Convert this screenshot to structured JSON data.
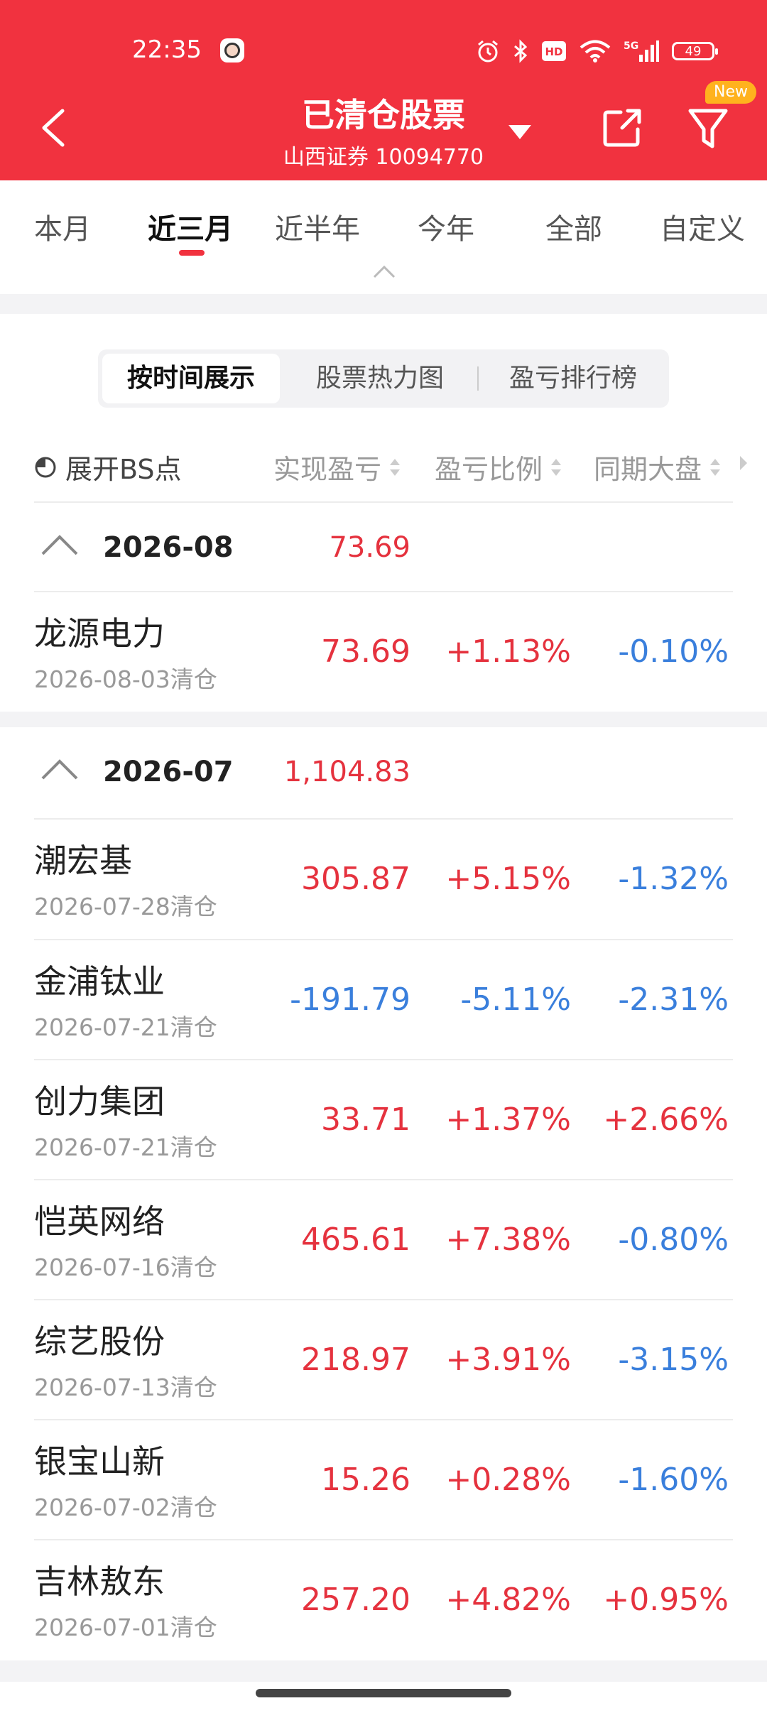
{
  "status_bar": {
    "time": "22:35",
    "battery": "49",
    "icons": [
      "alarm-icon",
      "bluetooth-icon",
      "hd-icon",
      "wifi-icon",
      "5g-signal-icon",
      "battery-icon"
    ]
  },
  "header": {
    "title": "已清仓股票",
    "subtitle": "山西证券 10094770",
    "new_badge": "New",
    "bg_color": "#f1323f"
  },
  "period_tabs": [
    {
      "label": "本月",
      "active": false
    },
    {
      "label": "近三月",
      "active": true
    },
    {
      "label": "近半年",
      "active": false
    },
    {
      "label": "今年",
      "active": false
    },
    {
      "label": "全部",
      "active": false
    },
    {
      "label": "自定义",
      "active": false
    }
  ],
  "view_tabs": [
    {
      "label": "按时间展示",
      "active": true
    },
    {
      "label": "股票热力图",
      "active": false
    },
    {
      "label": "盈亏排行榜",
      "active": false
    }
  ],
  "columns": {
    "bs_toggle": "展开BS点",
    "pnl": "实现盈亏",
    "ratio": "盈亏比例",
    "market": "同期大盘"
  },
  "colors": {
    "up": "#e5323e",
    "down": "#3a7fdc",
    "accent": "#f1323f"
  },
  "groups": [
    {
      "month": "2026-08",
      "total": "73.69",
      "rows": [
        {
          "name": "龙源电力",
          "date": "2026-08-03清仓",
          "pnl": "73.69",
          "pct": "+1.13%",
          "market": "-0.10%"
        }
      ]
    },
    {
      "month": "2026-07",
      "total": "1,104.83",
      "rows": [
        {
          "name": "潮宏基",
          "date": "2026-07-28清仓",
          "pnl": "305.87",
          "pct": "+5.15%",
          "market": "-1.32%"
        },
        {
          "name": "金浦钛业",
          "date": "2026-07-21清仓",
          "pnl": "-191.79",
          "pct": "-5.11%",
          "market": "-2.31%"
        },
        {
          "name": "创力集团",
          "date": "2026-07-21清仓",
          "pnl": "33.71",
          "pct": "+1.37%",
          "market": "+2.66%"
        },
        {
          "name": "恺英网络",
          "date": "2026-07-16清仓",
          "pnl": "465.61",
          "pct": "+7.38%",
          "market": "-0.80%"
        },
        {
          "name": "综艺股份",
          "date": "2026-07-13清仓",
          "pnl": "218.97",
          "pct": "+3.91%",
          "market": "-3.15%"
        },
        {
          "name": "银宝山新",
          "date": "2026-07-02清仓",
          "pnl": "15.26",
          "pct": "+0.28%",
          "market": "-1.60%"
        },
        {
          "name": "吉林敖东",
          "date": "2026-07-01清仓",
          "pnl": "257.20",
          "pct": "+4.82%",
          "market": "+0.95%"
        }
      ]
    }
  ]
}
